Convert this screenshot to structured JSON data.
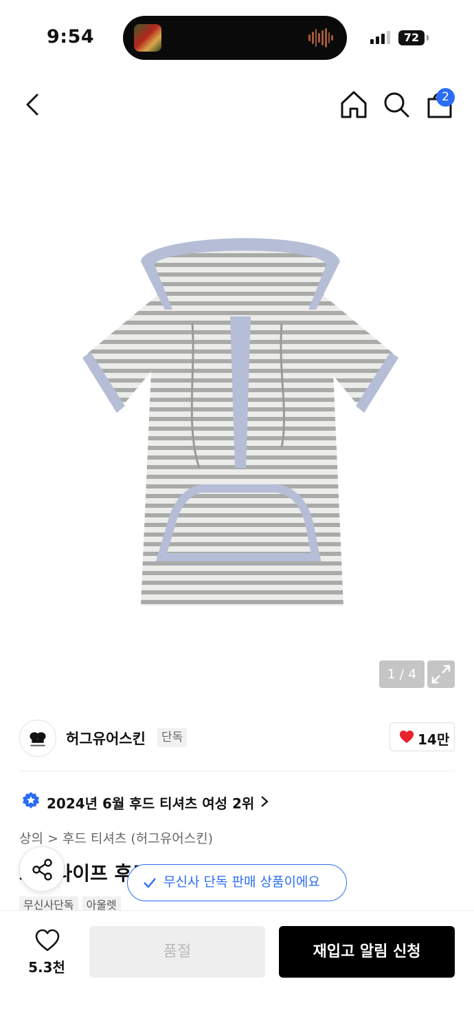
{
  "status_bar": {
    "time": "9:54",
    "battery": "72"
  },
  "nav": {
    "cart_count": "2"
  },
  "gallery": {
    "page_indicator": "1 / 4"
  },
  "brand": {
    "name": "허그유어스킨",
    "tag": "단독",
    "likes": "14만"
  },
  "ranking": {
    "text": "2024년 6월 후드 티셔츠 여성 2위"
  },
  "breadcrumb": {
    "items": [
      "상의",
      "후드 티셔츠 (허그유어스킨)"
    ]
  },
  "product": {
    "title": "스트라이프 후드",
    "tags": [
      "무신사단독",
      "아울렛"
    ]
  },
  "toast": {
    "text": "무신사 단독 판매 상품이에요"
  },
  "bottom": {
    "wish_count": "5.3천",
    "soldout_label": "품절",
    "restock_label": "재입고 알림 신청"
  },
  "colors": {
    "accent": "#2a6df4",
    "heart": "#e8232b",
    "primary_button": "#000000"
  }
}
